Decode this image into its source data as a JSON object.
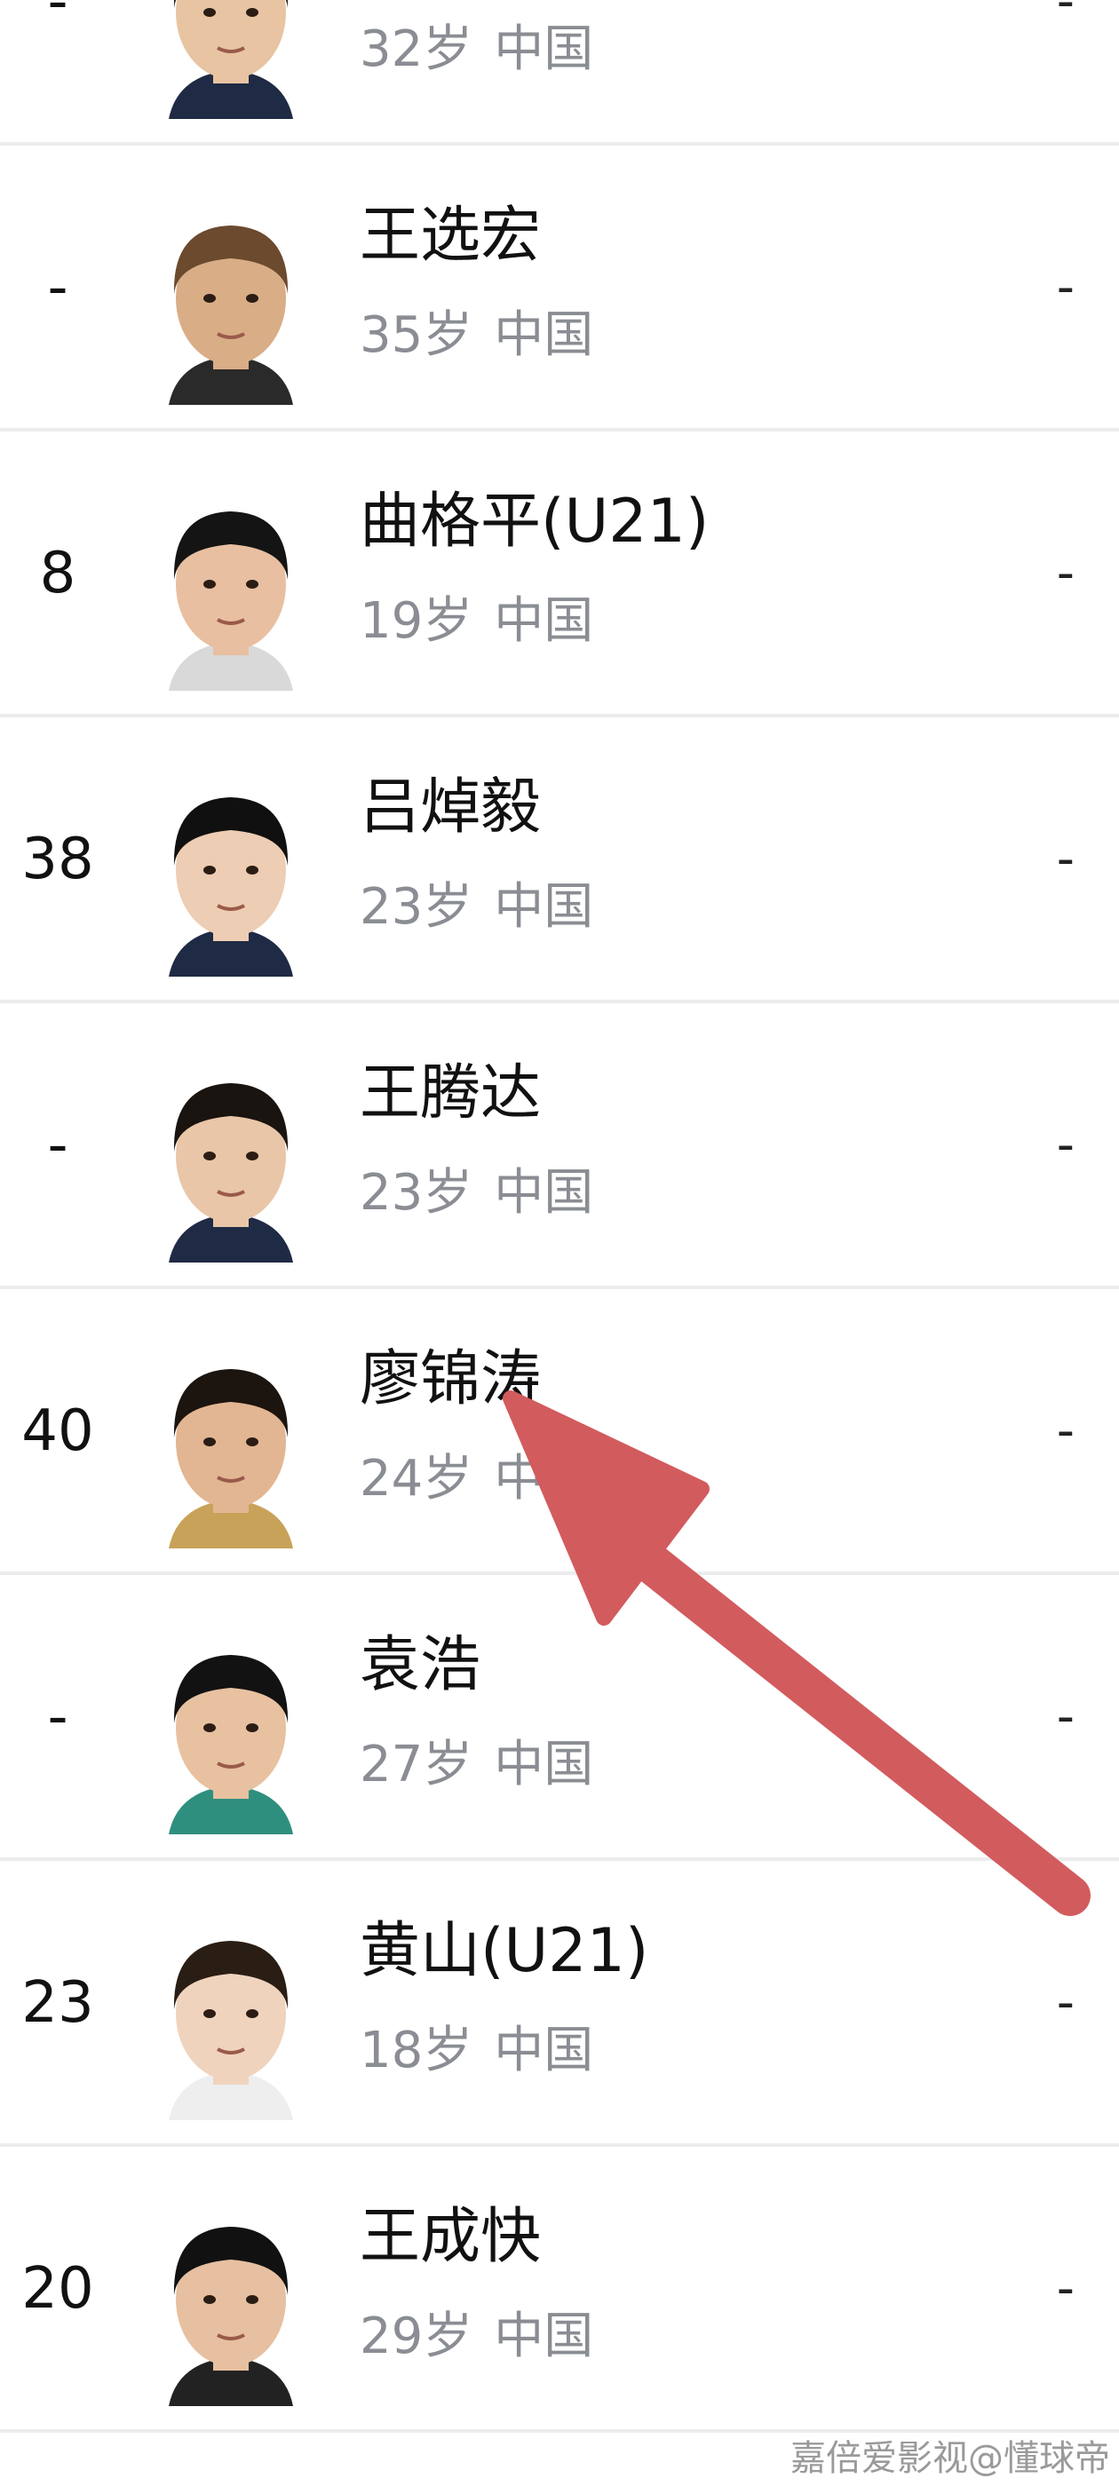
{
  "players": [
    {
      "number": "-",
      "name": "",
      "age": "32岁",
      "country": "中国",
      "stat": "-",
      "skin": "#e8c4a2",
      "hair": "#2a2018",
      "shirt": "#1f2a44"
    },
    {
      "number": "-",
      "name": "王选宏",
      "age": "35岁",
      "country": "中国",
      "stat": "-",
      "skin": "#d9ad86",
      "hair": "#6b4a2e",
      "shirt": "#2a2a2a"
    },
    {
      "number": "8",
      "name": "曲格平(U21)",
      "age": "19岁",
      "country": "中国",
      "stat": "-",
      "skin": "#e8bfa0",
      "hair": "#141414",
      "shirt": "#d9d9d9"
    },
    {
      "number": "38",
      "name": "吕焯毅",
      "age": "23岁",
      "country": "中国",
      "stat": "-",
      "skin": "#edcdb3",
      "hair": "#101010",
      "shirt": "#1f2a44"
    },
    {
      "number": "-",
      "name": "王腾达",
      "age": "23岁",
      "country": "中国",
      "stat": "-",
      "skin": "#e9c6a8",
      "hair": "#1a1410",
      "shirt": "#1f2a44"
    },
    {
      "number": "40",
      "name": "廖锦涛",
      "age": "24岁",
      "country": "中国",
      "stat": "-",
      "skin": "#e2b692",
      "hair": "#1c140e",
      "shirt": "#c9a25a"
    },
    {
      "number": "-",
      "name": "袁浩",
      "age": "27岁",
      "country": "中国",
      "stat": "-",
      "skin": "#e8c1a0",
      "hair": "#121212",
      "shirt": "#2f8f7e"
    },
    {
      "number": "23",
      "name": "黄山(U21)",
      "age": "18岁",
      "country": "中国",
      "stat": "-",
      "skin": "#f0d3bd",
      "hair": "#2a1d14",
      "shirt": "#eeeeee"
    },
    {
      "number": "20",
      "name": "王成快",
      "age": "29岁",
      "country": "中国",
      "stat": "-",
      "skin": "#e6c0a0",
      "hair": "#111111",
      "shirt": "#222222"
    }
  ],
  "annotation": {
    "arrow_color": "#d25b5e"
  },
  "watermark": "嘉倍爱影视@懂球帝"
}
